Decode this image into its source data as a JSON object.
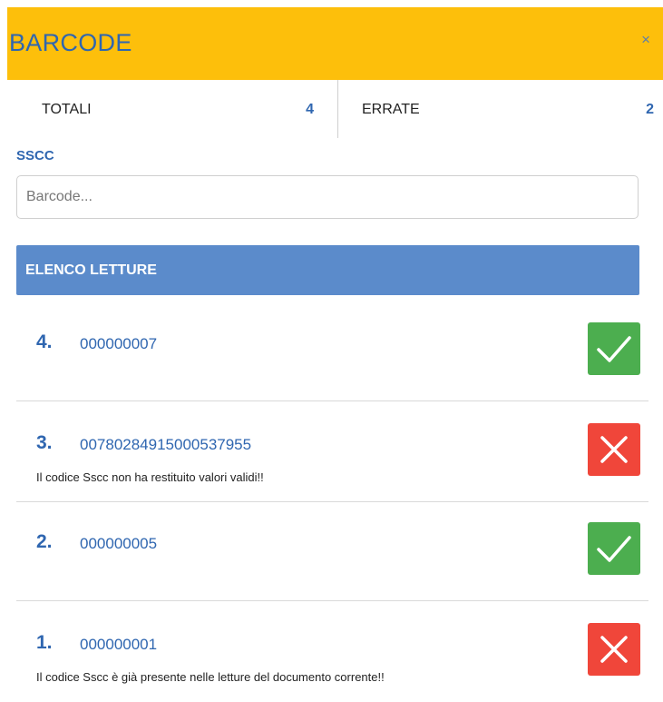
{
  "header": {
    "title": "BARCODE",
    "close_label": "×"
  },
  "stats": {
    "total_label": "TOTALI",
    "total_value": "4",
    "errors_label": "ERRATE",
    "errors_value": "2"
  },
  "sscc": {
    "label": "SSCC",
    "placeholder": "Barcode...",
    "value": ""
  },
  "list": {
    "title": "ELENCO LETTURE",
    "items": [
      {
        "number": "4.",
        "code": "000000007",
        "message": "",
        "status": "ok",
        "status_icon": "check-icon"
      },
      {
        "number": "3.",
        "code": "00780284915000537955",
        "message": "Il codice Sscc non ha restituito valori validi!!",
        "status": "error",
        "status_icon": "cross-icon"
      },
      {
        "number": "2.",
        "code": "000000005",
        "message": "",
        "status": "ok",
        "status_icon": "check-icon"
      },
      {
        "number": "1.",
        "code": "000000001",
        "message": "Il codice Sscc è già presente nelle letture del documento corrente!!",
        "status": "error",
        "status_icon": "cross-icon"
      }
    ]
  },
  "colors": {
    "header_bg": "#fdbf0b",
    "accent_blue": "#2f66b0",
    "list_header_bg": "#5b8bcb",
    "ok_green": "#4cae4f",
    "error_red": "#f0463a"
  }
}
